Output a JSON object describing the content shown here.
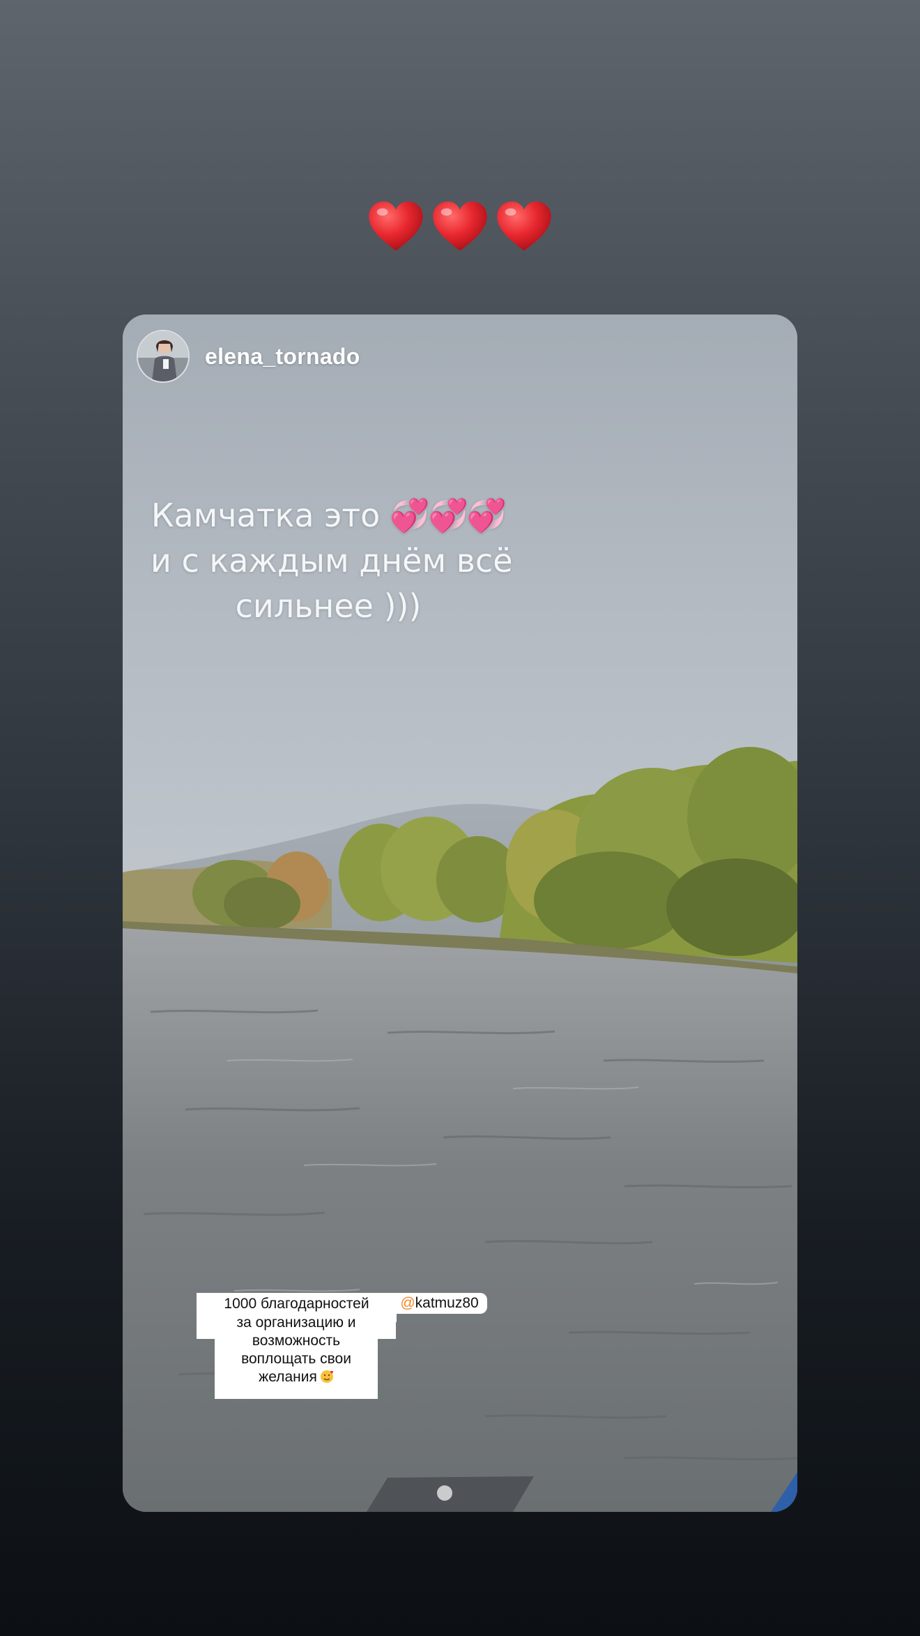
{
  "top_sticker": {
    "emoji": "❤️❤️❤️",
    "icon": "red-heart-emoji",
    "count": 3,
    "color": "#e8272f"
  },
  "story": {
    "author": {
      "username": "elena_tornado",
      "avatar_icon": "profile-avatar"
    },
    "caption": {
      "line1": "Камчатка это",
      "line1_emoji": "💞💞💞",
      "line2": "и с каждым днём всё",
      "line3": "сильнее )))"
    },
    "thanks_sticker": {
      "line1": "1000 благодарностей",
      "mention_at": "@",
      "mention": "katmuz80",
      "line2": "за организацию и",
      "line3": "возможность",
      "line4": "воплощать свои",
      "line5": "желания",
      "line5_emoji": "🥰"
    }
  },
  "colors": {
    "background_top": "#5f656d",
    "background_bottom": "#0c1014",
    "sky": "#a9b0b8",
    "water": "#7b7f82",
    "trees": "#8c9a43",
    "caption_text": "#f4f6f8",
    "caption_hearts": "#e94aa0"
  }
}
